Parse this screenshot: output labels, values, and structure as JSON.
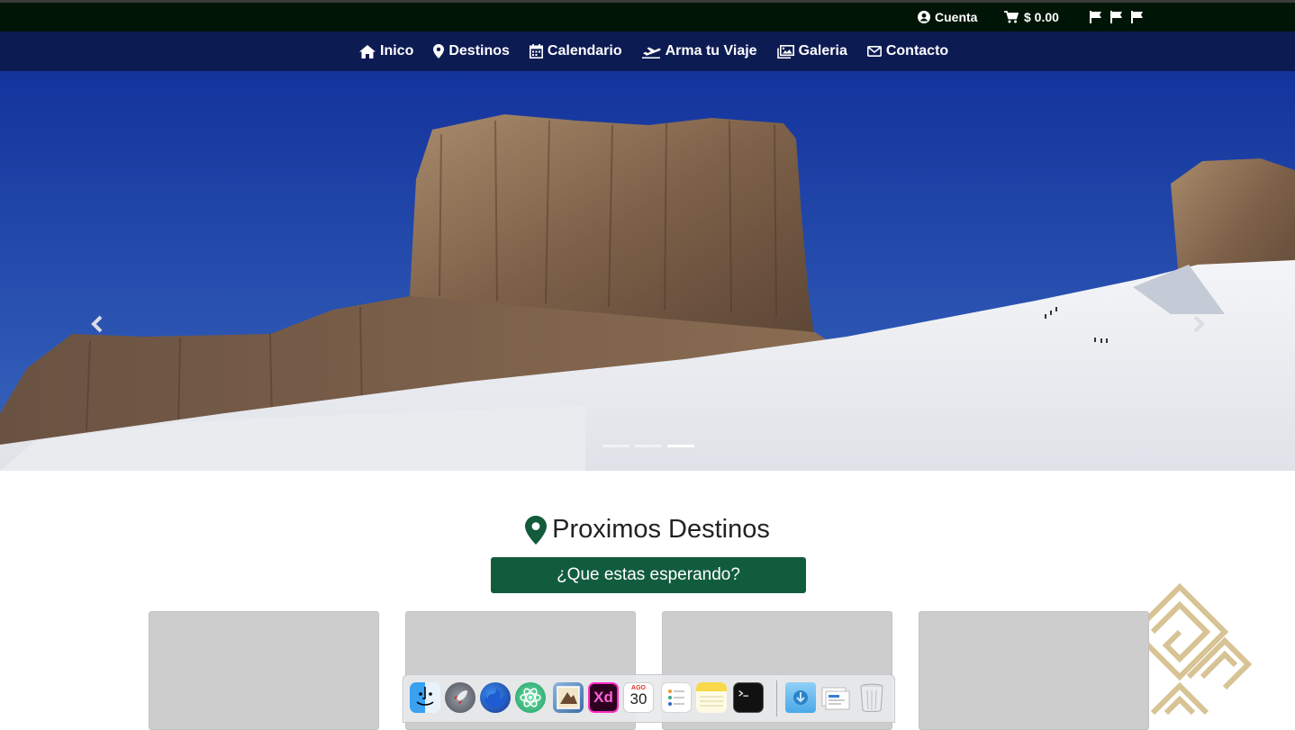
{
  "topbar": {
    "account_label": "Cuenta",
    "cart_label": "$ 0.00",
    "icons": [
      "user-circle-icon",
      "cart-icon",
      "flag-icon",
      "flag-icon",
      "flag-icon"
    ]
  },
  "nav": {
    "items": [
      {
        "label": "Inico",
        "icon": "home-icon"
      },
      {
        "label": "Destinos",
        "icon": "map-marker-icon"
      },
      {
        "label": "Calendario",
        "icon": "calendar-icon"
      },
      {
        "label": "Arma tu Viaje",
        "icon": "plane-icon"
      },
      {
        "label": "Galeria",
        "icon": "images-icon"
      },
      {
        "label": "Contacto",
        "icon": "envelope-icon"
      }
    ]
  },
  "carousel": {
    "slide_count": 3,
    "active_index": 2,
    "controls": [
      "prev",
      "next"
    ]
  },
  "destinations": {
    "title": "Proximos Destinos",
    "cta_label": "¿Que estas esperando?",
    "card_count": 4
  },
  "dock": {
    "apps": [
      "finder",
      "launchpad",
      "firefox",
      "atom",
      "mail-preview",
      "adobe-xd",
      "calendar",
      "reminders",
      "notes",
      "terminal",
      "downloads",
      "documents",
      "trash"
    ],
    "xd_label": "Xd",
    "calendar_month": "AGO",
    "calendar_day": "30"
  },
  "colors": {
    "topbar_bg": "#011507",
    "navbar_bg": "#0d1b53",
    "accent_green": "#125c3e",
    "card_placeholder": "#cdcdcd",
    "deco_gold": "#d8c394"
  }
}
